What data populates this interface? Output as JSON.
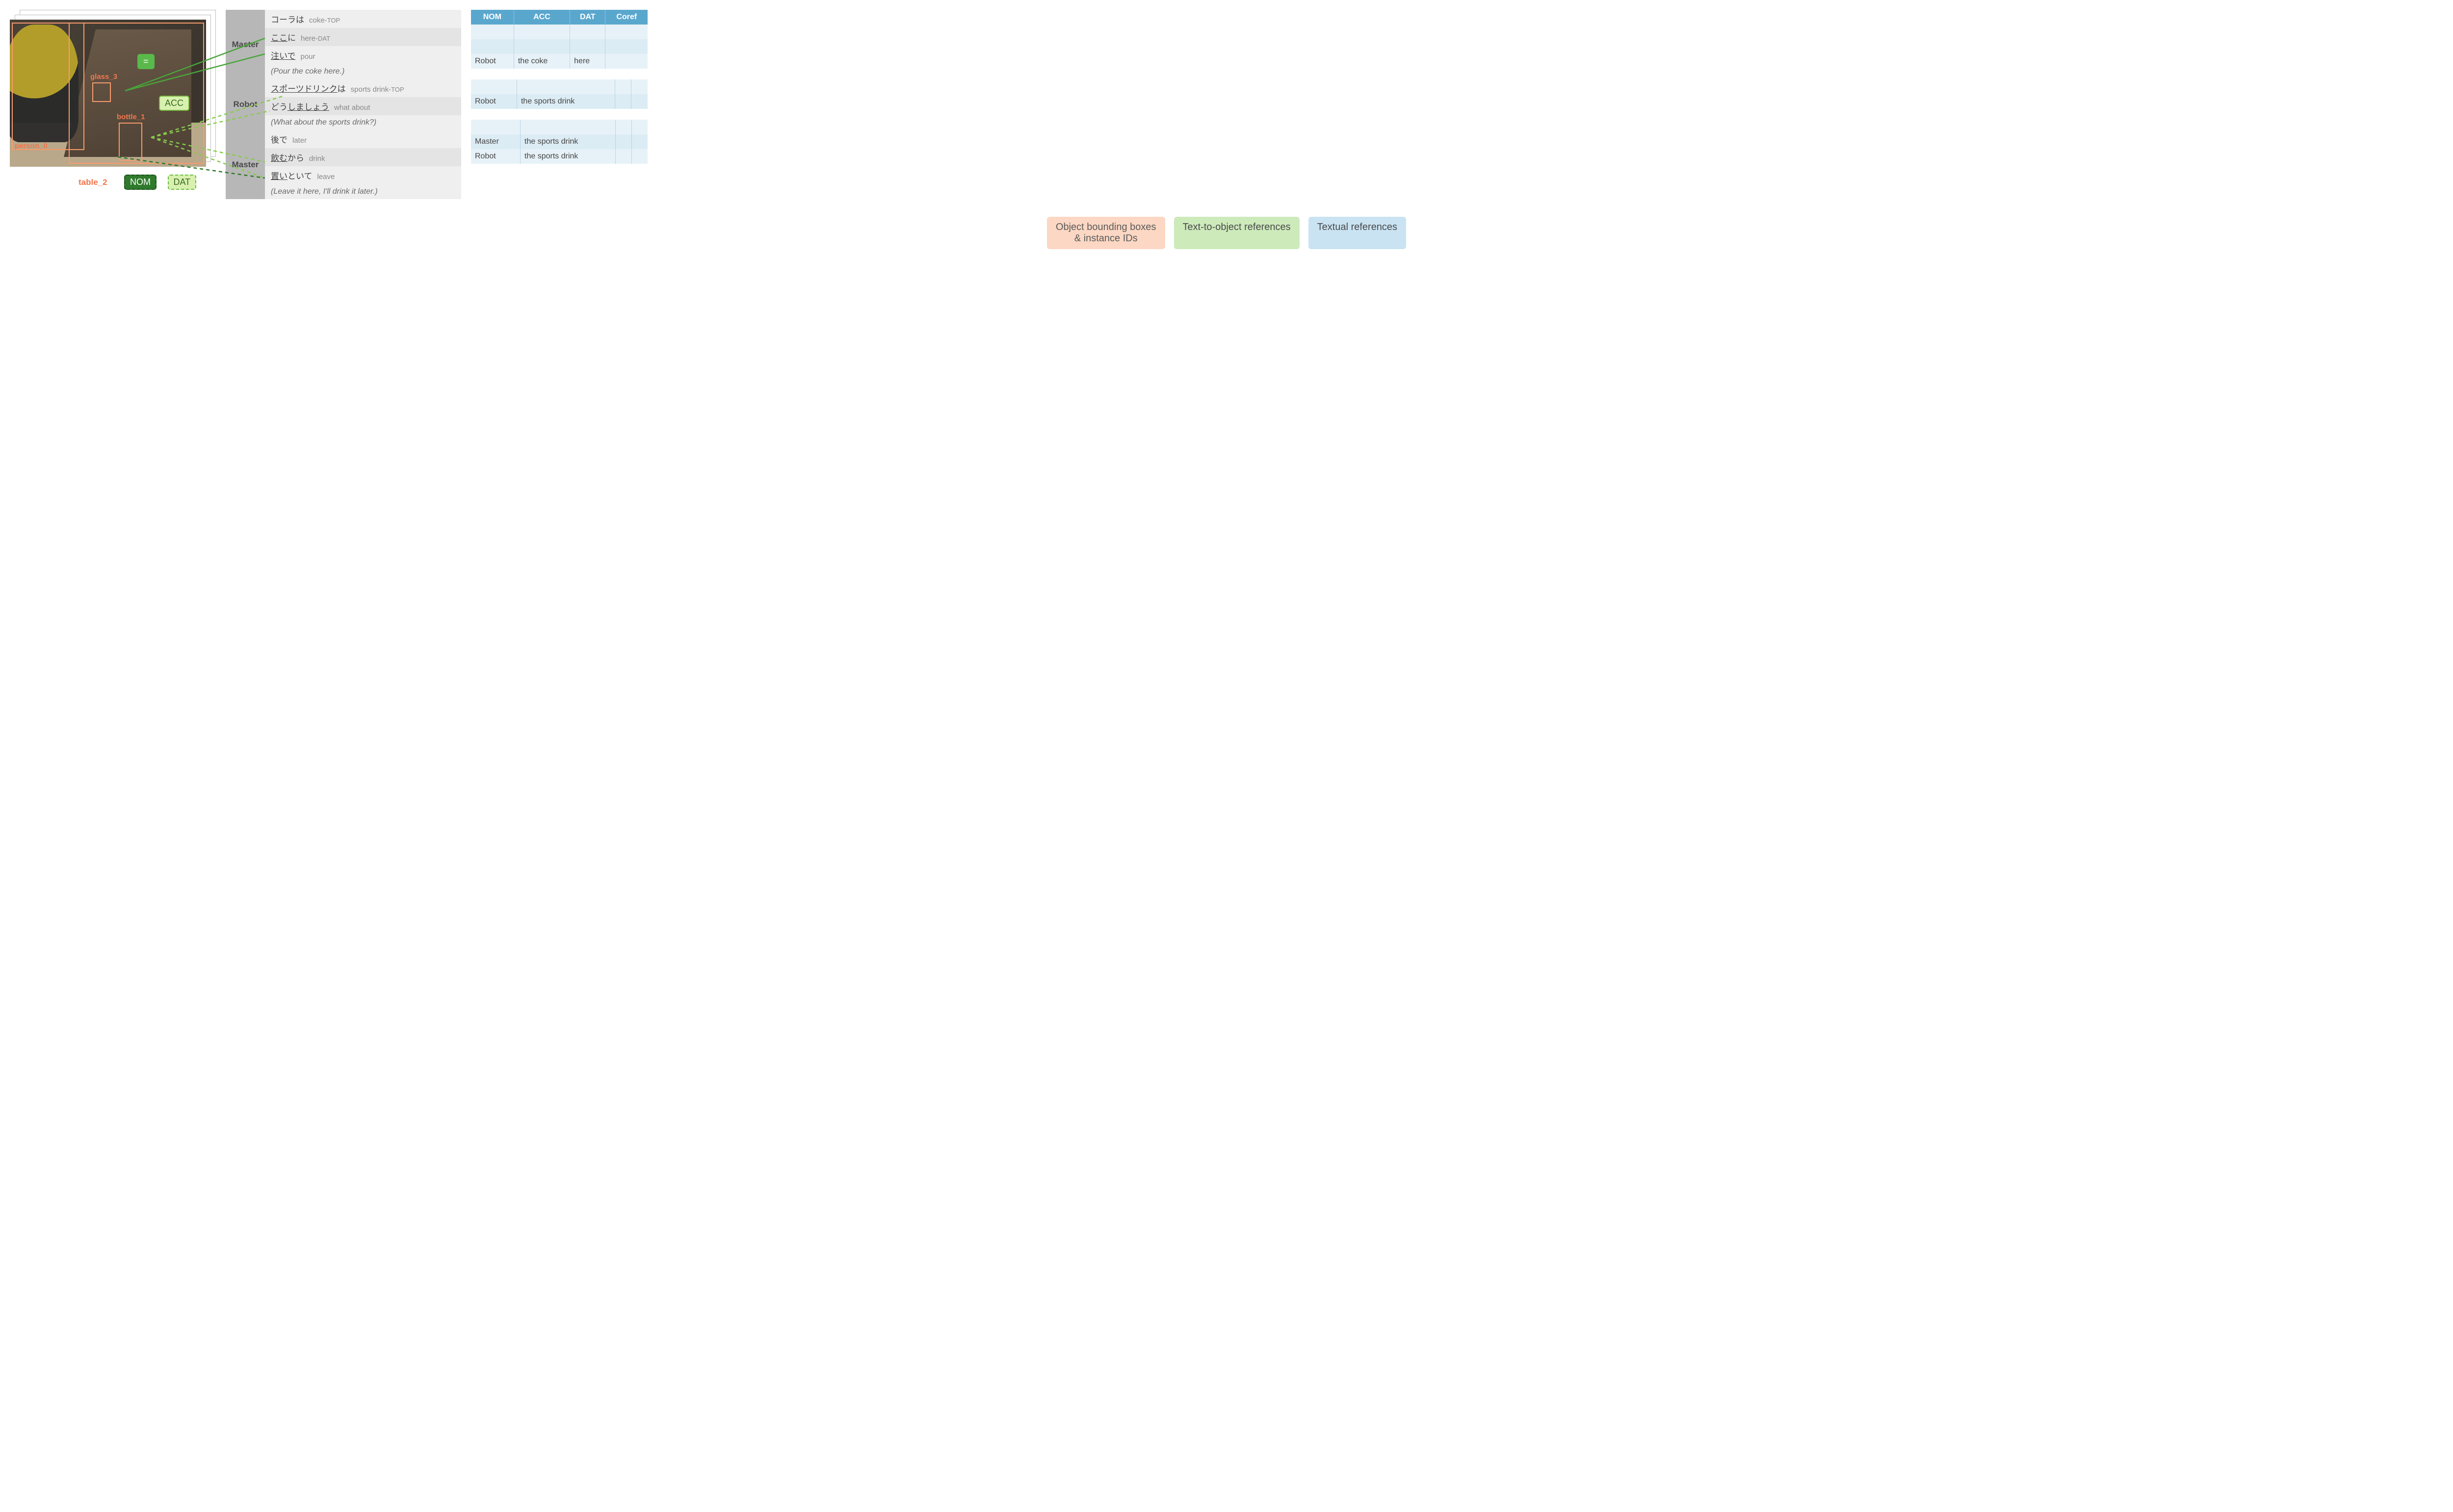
{
  "image": {
    "object_labels": {
      "person": "person_0",
      "table": "table_2",
      "glass": "glass_3",
      "bottle": "bottle_1"
    },
    "tags": {
      "eq": "=",
      "acc": "ACC",
      "nom": "NOM",
      "dat": "DAT"
    }
  },
  "dialogue": [
    {
      "speaker": "Master",
      "lines": [
        {
          "jp_pre": "コーラは",
          "jp_u": "",
          "jp_post": "",
          "gloss": "coke-",
          "gloss_sc": "TOP"
        },
        {
          "jp_pre": "",
          "jp_u": "ここ",
          "jp_post": "に",
          "gloss": "here-",
          "gloss_sc": "DAT"
        },
        {
          "jp_pre": "",
          "jp_u": "注いで",
          "jp_post": "",
          "gloss": "pour",
          "gloss_sc": ""
        }
      ],
      "translation": "(Pour the coke here.)"
    },
    {
      "speaker": "Robot",
      "lines": [
        {
          "jp_pre": "",
          "jp_u": "スポーツドリンク",
          "jp_post": "は",
          "gloss": "sports drink-",
          "gloss_sc": "TOP"
        },
        {
          "jp_pre": "どう",
          "jp_u": "しましょう",
          "jp_post": "",
          "gloss": "what about",
          "gloss_sc": ""
        }
      ],
      "translation": "(What about the sports drink?)"
    },
    {
      "speaker": "Master",
      "lines": [
        {
          "jp_pre": "後で",
          "jp_u": "",
          "jp_post": "",
          "gloss": "later",
          "gloss_sc": ""
        },
        {
          "jp_pre": "",
          "jp_u": "飲む",
          "jp_post": "から",
          "gloss": "drink",
          "gloss_sc": ""
        },
        {
          "jp_pre": "",
          "jp_u": "置い",
          "jp_post": "といて",
          "gloss": "leave",
          "gloss_sc": ""
        }
      ],
      "translation": "(Leave it here, I'll drink it later.)"
    }
  ],
  "ref_tables": {
    "headers": {
      "nom": "NOM",
      "acc": "ACC",
      "dat": "DAT",
      "coref": "Coref"
    },
    "groups": [
      [
        {
          "nom": "",
          "acc": "",
          "dat": "",
          "coref": ""
        },
        {
          "nom": "",
          "acc": "",
          "dat": "",
          "coref": ""
        },
        {
          "nom": "Robot",
          "acc": "the coke",
          "dat": "here",
          "coref": ""
        }
      ],
      [
        {
          "nom": "",
          "acc": "",
          "dat": "",
          "coref": ""
        },
        {
          "nom": "Robot",
          "acc": "the sports drink",
          "dat": "",
          "coref": ""
        }
      ],
      [
        {
          "nom": "",
          "acc": "",
          "dat": "",
          "coref": ""
        },
        {
          "nom": "Master",
          "acc": "the sports drink",
          "dat": "",
          "coref": ""
        },
        {
          "nom": "Robot",
          "acc": "the sports drink",
          "dat": "",
          "coref": ""
        }
      ]
    ]
  },
  "captions": {
    "orange_l1": "Object bounding boxes",
    "orange_l2": "& instance IDs",
    "green": "Text-to-object references",
    "blue": "Textual references"
  },
  "connections": {
    "eq_target": "glass_3",
    "acc_target": "bottle_1",
    "description": "solid green lines from ここ and 注いで to glass_3; dashed light-green lines from スポーツドリンク/しましょう/飲む/置い to bottle_1; dashed dark-green from 置い to table_2"
  }
}
